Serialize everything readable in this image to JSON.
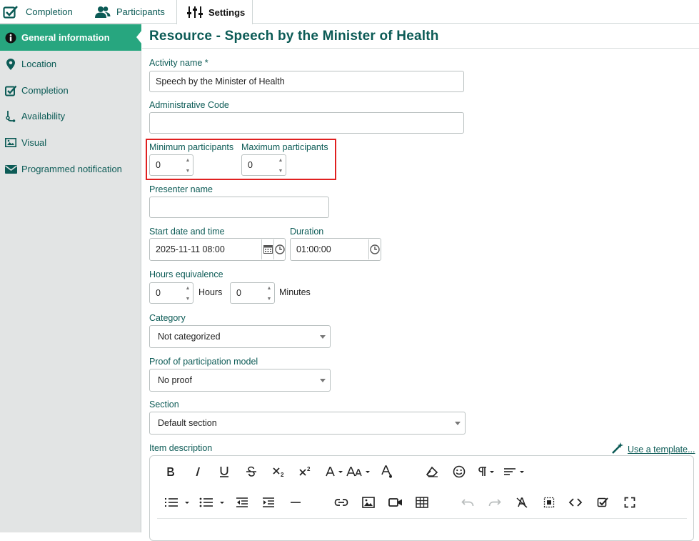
{
  "tabs": [
    {
      "label": "Completion",
      "icon": "checkbox-icon"
    },
    {
      "label": "Participants",
      "icon": "users-icon"
    },
    {
      "label": "Settings",
      "icon": "sliders-icon",
      "active": true
    }
  ],
  "sidebar": {
    "items": [
      {
        "label": "General information",
        "icon": "info-icon",
        "active": true
      },
      {
        "label": "Location",
        "icon": "location-pin-icon"
      },
      {
        "label": "Completion",
        "icon": "checkbox-icon"
      },
      {
        "label": "Availability",
        "icon": "route-icon"
      },
      {
        "label": "Visual",
        "icon": "image-icon"
      },
      {
        "label": "Programmed notification",
        "icon": "envelope-icon"
      }
    ]
  },
  "page": {
    "title": "Resource - Speech by the Minister of Health"
  },
  "form": {
    "activity_name": {
      "label": "Activity name *",
      "value": "Speech by the Minister of Health"
    },
    "admin_code": {
      "label": "Administrative Code",
      "value": ""
    },
    "min_participants": {
      "label": "Minimum participants",
      "value": "0"
    },
    "max_participants": {
      "label": "Maximum participants",
      "value": "0"
    },
    "presenter": {
      "label": "Presenter name",
      "value": ""
    },
    "start": {
      "label": "Start date and time",
      "value": "2025-11-11 08:00"
    },
    "duration": {
      "label": "Duration",
      "value": "01:00:00"
    },
    "hours_equivalence": {
      "label": "Hours equivalence",
      "hours_value": "0",
      "hours_unit": "Hours",
      "minutes_value": "0",
      "minutes_unit": "Minutes"
    },
    "category": {
      "label": "Category",
      "value": "Not categorized"
    },
    "proof": {
      "label": "Proof of participation model",
      "value": "No proof"
    },
    "section": {
      "label": "Section",
      "value": "Default section"
    },
    "description": {
      "label": "Item description",
      "template_link": "Use a template..."
    }
  },
  "editor_toolbar": {
    "row1": [
      "bold-icon",
      "italic-icon",
      "underline-icon",
      "strikethrough-icon",
      "subscript-icon",
      "superscript-icon",
      "text-color-icon",
      "font-size-icon",
      "background-color-icon",
      "clear-format-icon",
      "emoji-icon",
      "paragraph-format-icon",
      "align-icon"
    ],
    "row2": [
      "ordered-list-icon",
      "unordered-list-icon",
      "outdent-icon",
      "indent-icon",
      "horizontal-line-icon",
      "link-icon",
      "insert-image-icon",
      "insert-video-icon",
      "insert-table-icon",
      "undo-icon",
      "redo-icon",
      "remove-format-icon",
      "select-all-icon",
      "code-view-icon",
      "spellcheck-icon",
      "fullscreen-icon"
    ]
  },
  "colors": {
    "accent": "#27a67f",
    "label_teal": "#0c5b56",
    "highlight_red": "#e02020",
    "sidebar_bg": "#e2e4e4"
  }
}
